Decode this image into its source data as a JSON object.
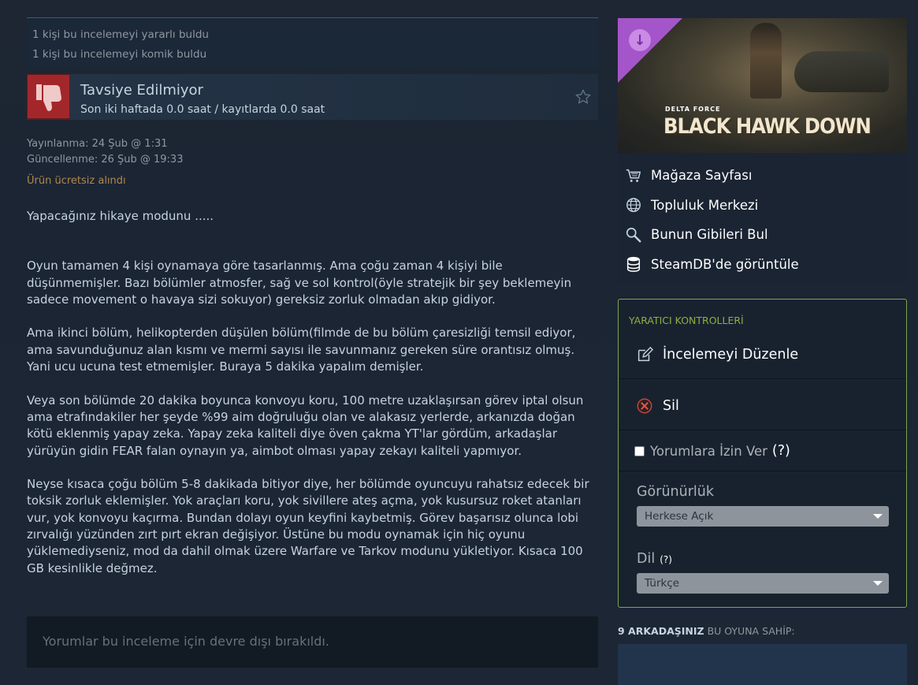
{
  "helpful": {
    "useful": "1 kişi bu incelemeyi yararlı buldu",
    "funny": "1 kişi bu incelemeyi komik buldu"
  },
  "recommendation": {
    "title": "Tavsiye Edilmiyor",
    "hours": "Son iki haftada 0.0 saat / kayıtlarda 0.0 saat"
  },
  "meta": {
    "posted": "Yayınlanma: 24 Şub @ 1:31",
    "updated": "Güncellenme: 26 Şub @ 19:33",
    "free": "Ürün ücretsiz alındı"
  },
  "review": {
    "paragraphs": [
      "Yapacağınız hikaye modunu .....",
      "Oyun tamamen 4 kişi oynamaya göre tasarlanmış. Ama çoğu zaman 4 kişiyi bile düşünmemişler. Bazı bölümler atmosfer, sağ ve sol kontrol(öyle stratejik bir şey beklemeyin sadece movement o havaya sizi sokuyor) gereksiz zorluk olmadan akıp gidiyor.",
      "Ama ikinci bölüm, helikopterden düşülen bölüm(filmde de bu bölüm çaresizliği temsil ediyor, ama savunduğunuz alan kısmı ve mermi sayısı ile savunmanız gereken süre orantısız olmuş. Yani ucu ucuna test etmemişler. Buraya 5 dakika yapalım demişler.",
      "Veya son bölümde 20 dakika boyunca konvoyu koru, 100 metre uzaklaşırsan görev iptal olsun ama etrafındakiler her şeyde %99 aim doğruluğu olan ve alakasız yerlerde, arkanızda doğan kötü eklenmiş yapay zeka. Yapay zeka kaliteli diye öven çakma YT'lar gördüm, arkadaşlar yürüyün gidin FEAR falan oynayın ya, aimbot olması yapay zekayı kaliteli yapmıyor.",
      "Neyse kısaca çoğu bölüm 5-8 dakikada bitiyor diye, her bölümde oyuncuyu rahatsız edecek bir toksik zorluk eklemişler. Yok araçları koru, yok sivillere ateş açma, yok kusursuz roket atanları vur, yok konvoyu kaçırma. Bundan dolayı oyun keyfini kaybetmiş. Görev başarısız olunca lobi zırvalığı yüzünden zırt pırt ekran değişiyor. Üstüne bu modu oynamak için hiç oyunu yüklemediyseniz, mod da dahil olmak üzere Warfare ve Tarkov modunu yükletiyor. Kısaca 100 GB kesinlikle değmez."
    ]
  },
  "comments_disabled": "Yorumlar bu inceleme için devre dışı bırakıldı.",
  "game": {
    "logo_small": "DELTA FORCE",
    "logo_main": "BLACK HAWK DOWN",
    "links": [
      {
        "label": "Mağaza Sayfası",
        "icon": "cart-icon"
      },
      {
        "label": "Topluluk Merkezi",
        "icon": "globe-icon"
      },
      {
        "label": "Bunun Gibileri Bul",
        "icon": "magnifier-icon"
      },
      {
        "label": "SteamDB'de görüntüle",
        "icon": "database-icon"
      }
    ]
  },
  "creator": {
    "title": "YARATICI KONTROLLERİ",
    "edit": "İncelemeyi Düzenle",
    "delete": "Sil",
    "allow_comments": "Yorumlara İzin Ver",
    "help": "(?)",
    "visibility_label": "Görünürlük",
    "visibility_value": "Herkese Açık",
    "language_label": "Dil",
    "language_value": "Türkçe"
  },
  "friends": {
    "count": "9 ARKADAŞINIZ",
    "text": " BU OYUNA SAHİP:"
  },
  "colors": {
    "accent_green": "#8bb140",
    "thumb_red": "#a3272a",
    "free_gold": "#b0884c",
    "corner_purple": "#a455c9"
  }
}
